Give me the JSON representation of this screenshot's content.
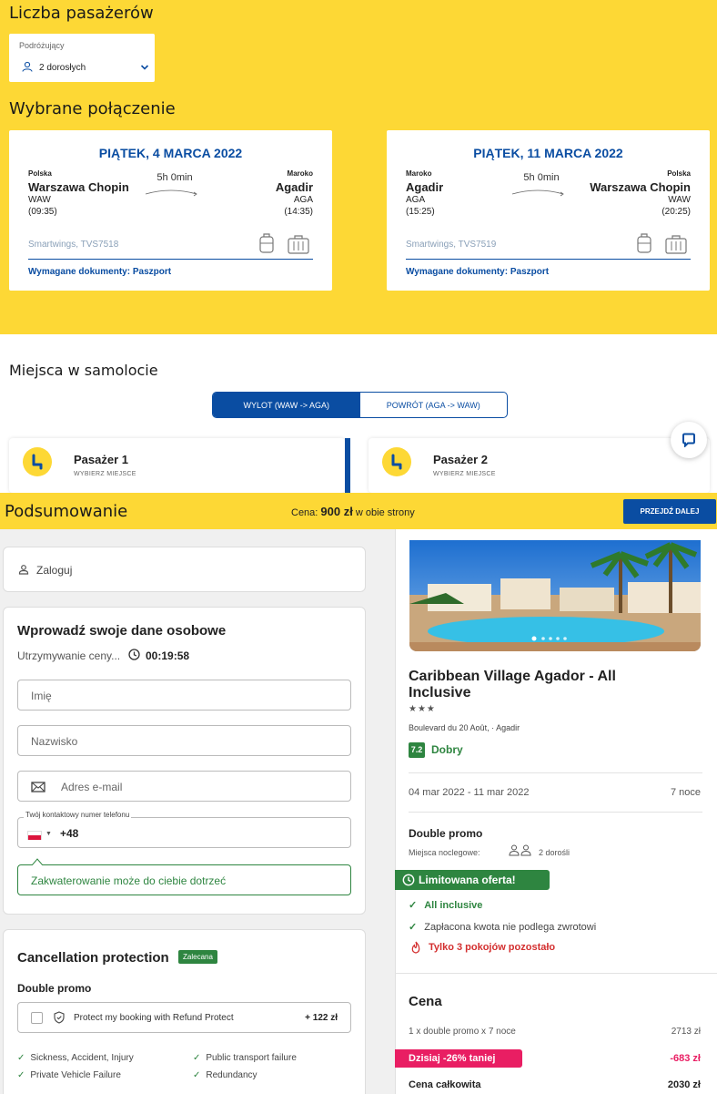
{
  "passengers": {
    "title": "Liczba pasażerów",
    "travellers_label": "Podróżujący",
    "travellers_value": "2 dorosłych"
  },
  "connection": {
    "title": "Wybrane połączenie",
    "outbound": {
      "date": "PIĄTEK, 4 MARCA 2022",
      "from_country": "Polska",
      "from_city": "Warszawa Chopin",
      "from_code": "WAW",
      "from_time": "(09:35)",
      "duration": "5h 0min",
      "to_country": "Maroko",
      "to_city": "Agadir",
      "to_code": "AGA",
      "to_time": "(14:35)",
      "carrier": "Smartwings, TVS7518",
      "documents": "Wymagane dokumenty: Paszport"
    },
    "return": {
      "date": "PIĄTEK, 11 MARCA 2022",
      "from_country": "Maroko",
      "from_city": "Agadir",
      "from_code": "AGA",
      "from_time": "(15:25)",
      "duration": "5h 0min",
      "to_country": "Polska",
      "to_city": "Warszawa Chopin",
      "to_code": "WAW",
      "to_time": "(20:25)",
      "carrier": "Smartwings, TVS7519",
      "documents": "Wymagane dokumenty: Paszport"
    }
  },
  "seats": {
    "title": "Miejsca w samolocie",
    "tabs": [
      "WYLOT (WAW -> AGA)",
      "POWRÓT (AGA -> WAW)"
    ],
    "passengers": [
      {
        "name": "Pasażer 1",
        "action": "WYBIERZ MIEJSCE"
      },
      {
        "name": "Pasażer 2",
        "action": "WYBIERZ MIEJSCE"
      }
    ]
  },
  "summary": {
    "title": "Podsumowanie",
    "price_label": "Cena:",
    "price_value": "900 zł",
    "price_suffix": "w obie strony",
    "next_button": "PRZEJDŹ DALEJ"
  },
  "login": {
    "label": "Zaloguj"
  },
  "personal": {
    "title": "Wprowadź swoje dane osobowe",
    "hold_label": "Utrzymywanie ceny...",
    "timer": "00:19:58",
    "first_name_placeholder": "Imię",
    "last_name_placeholder": "Nazwisko",
    "email_placeholder": "Adres e-mail",
    "phone_label": "Twój kontaktowy numer telefonu",
    "phone_prefix": "+48",
    "tip": "Zakwaterowanie może do ciebie dotrzeć"
  },
  "cancellation": {
    "title": "Cancellation protection",
    "badge": "Zalecana",
    "room": "Double promo",
    "option_label": "Protect my booking with Refund Protect",
    "option_price": "+ 122 zł",
    "features": [
      "Sickness, Accident, Injury",
      "Public transport failure",
      "Private Vehicle Failure",
      "Redundancy"
    ]
  },
  "hotel": {
    "name": "Caribbean Village Agador - All Inclusive",
    "stars": "★★★",
    "address": "Boulevard du 20 Août, · Agadir",
    "rating": "7.2",
    "rating_text": "Dobry",
    "dates": "04 mar 2022 - 11 mar 2022",
    "nights": "7 noce",
    "room": "Double promo",
    "beds_label": "Miejsca noclegowe:",
    "beds_value": "2 dorośli",
    "limited": "Limitowana oferta!",
    "inclusive": "All inclusive",
    "nonrefundable": "Zapłacona kwota nie podlega zwrotowi",
    "rooms_left": "Tylko 3 pokojów pozostało",
    "price_title": "Cena",
    "price_line_label": "1 x double promo x 7 noce",
    "price_line_value": "2713 zł",
    "discount_label": "Dzisiaj -26% taniej",
    "discount_value": "-683 zł",
    "total_label": "Cena całkowita",
    "total_value": "2030 zł"
  },
  "colors": {
    "yellow": "#fdd835",
    "blue": "#0a4da2",
    "green": "#2e8540",
    "pink": "#e91e63"
  }
}
